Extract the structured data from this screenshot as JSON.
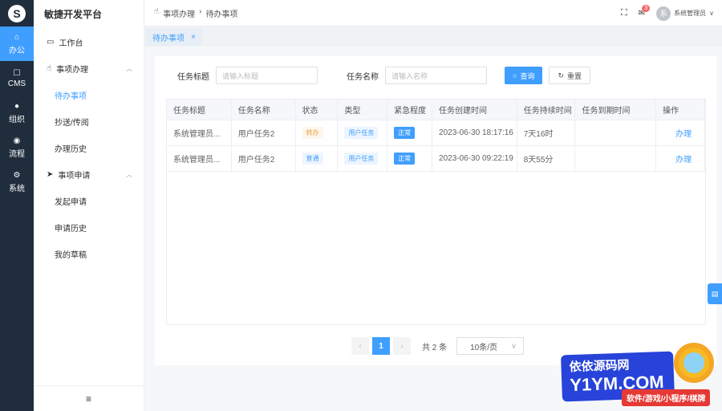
{
  "rail": {
    "logo": "S",
    "items": [
      {
        "label": "办公",
        "icon": "home-icon"
      },
      {
        "label": "CMS",
        "icon": "edit-icon"
      },
      {
        "label": "组织",
        "icon": "user-icon"
      },
      {
        "label": "流程",
        "icon": "flow-icon"
      },
      {
        "label": "系统",
        "icon": "gear-icon"
      }
    ]
  },
  "menu": {
    "title": "敏捷开发平台",
    "workbench": "工作台",
    "group1": "事项办理",
    "group1_items": [
      "待办事项",
      "抄送/传阅",
      "办理历史"
    ],
    "group2": "事项申请",
    "group2_items": [
      "发起申请",
      "申请历史",
      "我的草稿"
    ],
    "collapse_icon": "≡"
  },
  "header": {
    "breadcrumb": [
      "事项办理",
      "待办事项"
    ],
    "notification_count": "3",
    "avatar_text": "系",
    "username": "系统管理员"
  },
  "tabs": [
    {
      "label": "待办事项"
    }
  ],
  "search": {
    "title_label": "任务标题",
    "title_placeholder": "请输入标题",
    "name_label": "任务名称",
    "name_placeholder": "请输入名称",
    "query_button": "查询",
    "reset_button": "重置"
  },
  "table": {
    "columns": [
      "任务标题",
      "任务名称",
      "状态",
      "类型",
      "紧急程度",
      "任务创建时间",
      "任务持续时间",
      "任务到期时间",
      "操作"
    ],
    "rows": [
      {
        "title": "系统管理员...",
        "name": "用户任务2",
        "status": "转办",
        "status_color": "#e6a23c",
        "type": "用户任务",
        "urgency": "正常",
        "created": "2023-06-30 18:17:16",
        "duration": "7天16时",
        "due": "",
        "action": "办理"
      },
      {
        "title": "系统管理员...",
        "name": "用户任务2",
        "status": "普通",
        "status_color": "#409eff",
        "type": "用户任务",
        "urgency": "正常",
        "created": "2023-06-30 09:22:19",
        "duration": "8天55分",
        "due": "",
        "action": "办理"
      }
    ]
  },
  "pagination": {
    "current": "1",
    "total": "共 2 条",
    "page_size": "10条/页"
  },
  "watermark": {
    "line1": "依依源码网",
    "line2": "Y1YM.COM",
    "line3": "软件/游戏/小程序/棋牌"
  },
  "colors": {
    "accent": "#409eff",
    "rail": "#1f2d3d"
  }
}
